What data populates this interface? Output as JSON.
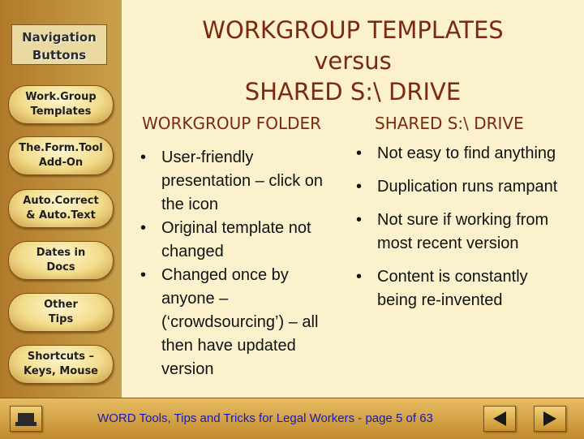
{
  "sidebar": {
    "heading": "Navigation\nButtons",
    "buttons": [
      {
        "label": "Work.Group\nTemplates"
      },
      {
        "label": "The.Form.Tool\nAdd-On"
      },
      {
        "label": "Auto.Correct\n& Auto.Text"
      },
      {
        "label": "Dates in\nDocs"
      },
      {
        "label": "Other\nTips"
      },
      {
        "label": "Shortcuts –\nKeys, Mouse"
      }
    ]
  },
  "slide": {
    "title": "WORKGROUP TEMPLATES\nversus\nSHARED S:\\ DRIVE",
    "left_column": {
      "heading": "WORKGROUP FOLDER",
      "bullets": [
        "User-friendly presentation – click on the icon",
        "Original template not changed",
        "Changed once by anyone – (‘crowdsourcing’) – all then have updated version"
      ]
    },
    "right_column": {
      "heading": "SHARED S:\\ DRIVE",
      "bullets": [
        "Not easy to find anything",
        "Duplication runs rampant",
        "Not sure if working from most recent version",
        "Content is constantly being re-invented"
      ]
    }
  },
  "footer": {
    "text": "WORD Tools, Tips and Tricks for Legal Workers  - page 5 of 63",
    "icons": [
      "home-icon",
      "back-arrow-icon",
      "forward-arrow-icon"
    ]
  },
  "colors": {
    "title": "#7a2a0f",
    "footer_text": "#1a1ab0",
    "background": "#fbf2cd"
  }
}
